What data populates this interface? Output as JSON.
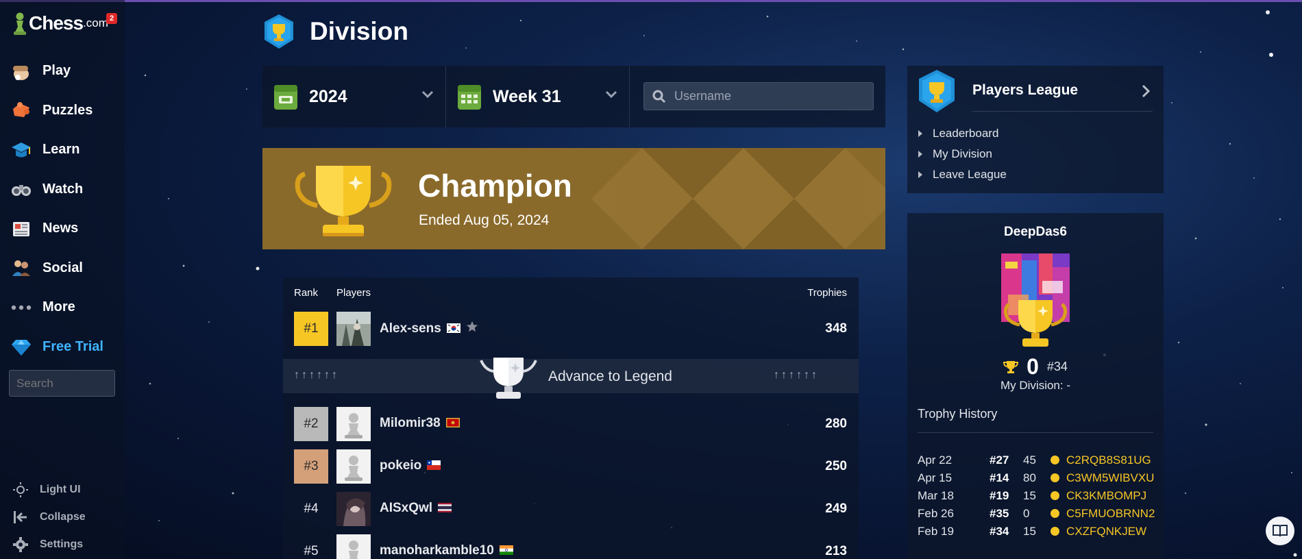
{
  "app": {
    "logo_text": "Chess",
    "logo_suffix": ".com",
    "notification_count": "2"
  },
  "sidebar": {
    "items": [
      {
        "label": "Play",
        "icon": "play-hand-icon"
      },
      {
        "label": "Puzzles",
        "icon": "puzzle-icon"
      },
      {
        "label": "Learn",
        "icon": "graduation-cap-icon"
      },
      {
        "label": "Watch",
        "icon": "binoculars-icon"
      },
      {
        "label": "News",
        "icon": "newspaper-icon"
      },
      {
        "label": "Social",
        "icon": "people-icon"
      },
      {
        "label": "More",
        "icon": "more-dots-icon"
      },
      {
        "label": "Free Trial",
        "icon": "diamond-icon"
      }
    ],
    "search_placeholder": "Search",
    "bottom": [
      {
        "label": "Light UI",
        "icon": "sun-icon"
      },
      {
        "label": "Collapse",
        "icon": "collapse-arrow-icon"
      },
      {
        "label": "Settings",
        "icon": "gear-icon"
      }
    ]
  },
  "header": {
    "title": "Division"
  },
  "filters": {
    "year": "2024",
    "week": "Week 31",
    "username_placeholder": "Username"
  },
  "banner": {
    "title": "Champion",
    "subtitle": "Ended Aug 05, 2024"
  },
  "table": {
    "col_rank": "Rank",
    "col_players": "Players",
    "col_trophies": "Trophies",
    "rows": [
      {
        "rank": "#1",
        "name": "Alex-sens",
        "trophies": "348"
      },
      {
        "rank": "#2",
        "name": "Milomir38",
        "trophies": "280"
      },
      {
        "rank": "#3",
        "name": "pokeio",
        "trophies": "250"
      },
      {
        "rank": "#4",
        "name": "AISxQwl",
        "trophies": "249"
      },
      {
        "rank": "#5",
        "name": "manoharkamble10",
        "trophies": "213"
      }
    ],
    "advance_label": "Advance to Legend",
    "advance_arrows_left": "↑↑↑↑↑↑",
    "advance_arrows_right": "↑↑↑↑↑↑"
  },
  "league": {
    "title": "Players League",
    "links": [
      "Leaderboard",
      "My Division",
      "Leave League"
    ]
  },
  "profile": {
    "username": "DeepDas6",
    "trophies": "0",
    "rank": "#34",
    "division": "My Division: -",
    "history_title": "Trophy History",
    "history": [
      {
        "date": "Apr 22",
        "rank": "#27",
        "value": "45",
        "code": "C2RQB8S81UG"
      },
      {
        "date": "Apr 15",
        "rank": "#14",
        "value": "80",
        "code": "C3WM5WIBVXU"
      },
      {
        "date": "Mar 18",
        "rank": "#19",
        "value": "15",
        "code": "CK3KMBOMPJ"
      },
      {
        "date": "Feb 26",
        "rank": "#35",
        "value": "0",
        "code": "C5FMUOBRNN2"
      },
      {
        "date": "Feb 19",
        "rank": "#34",
        "value": "15",
        "code": "CXZFQNKJEW"
      }
    ]
  },
  "colors": {
    "accent_gold": "#f6c625",
    "banner_gold": "#8a6a2b",
    "free_trial_blue": "#3fb3ff",
    "rank_silver": "#b9b9b9",
    "rank_bronze": "#d4a07a"
  }
}
